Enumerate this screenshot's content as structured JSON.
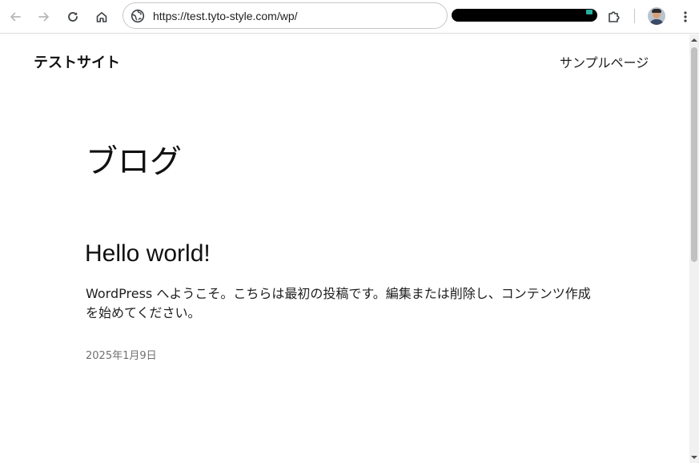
{
  "browser": {
    "url": "https://test.tyto-style.com/wp/",
    "icons": {
      "back": "arrow-left-icon",
      "forward": "arrow-right-icon",
      "reload": "reload-icon",
      "home": "home-icon",
      "site_info": "site-info-icon",
      "extensions": "puzzle-icon",
      "profile": "avatar",
      "menu": "kebab-menu-icon"
    }
  },
  "site": {
    "title": "テストサイト",
    "nav": [
      {
        "label": "サンプルページ"
      }
    ]
  },
  "page": {
    "heading": "ブログ"
  },
  "posts": [
    {
      "title": "Hello world!",
      "excerpt": "WordPress へようこそ。こちらは最初の投稿です。編集または削除し、コンテンツ作成を始めてください。",
      "date": "2025年1月9日"
    }
  ],
  "colors": {
    "text": "#1e1e1e",
    "muted": "#707070",
    "background": "#ffffff"
  }
}
